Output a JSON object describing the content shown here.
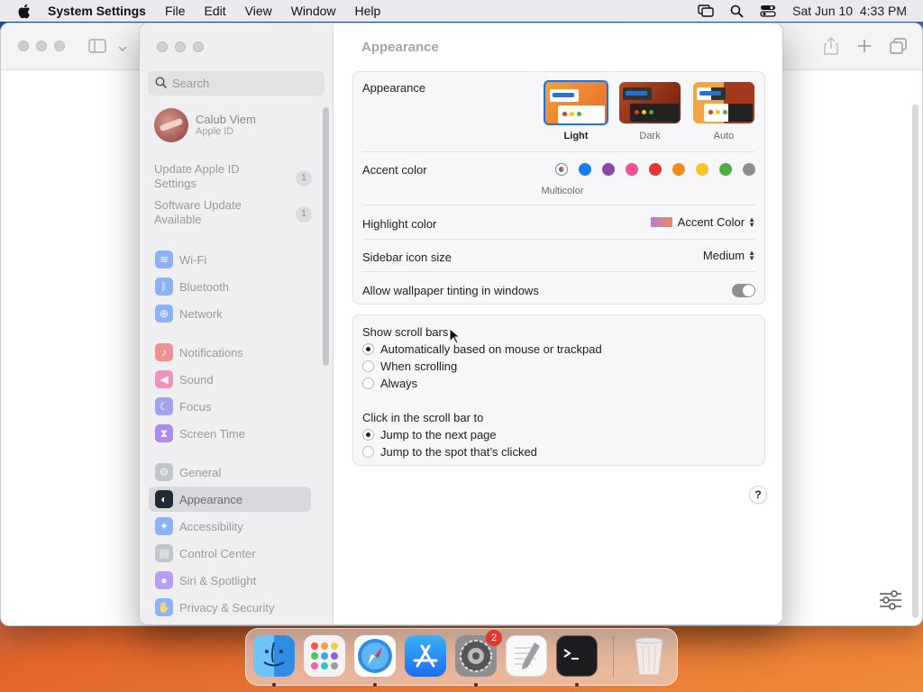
{
  "menubar": {
    "app": "System Settings",
    "menus": [
      "File",
      "Edit",
      "View",
      "Window",
      "Help"
    ],
    "datetime": "Sat Jun 10  4:33 PM"
  },
  "sidebar": {
    "search_placeholder": "Search",
    "profile": {
      "name": "Calub Viem",
      "subtitle": "Apple ID"
    },
    "notices": [
      {
        "label": "Update Apple ID Settings",
        "count": "1"
      },
      {
        "label": "Software Update Available",
        "count": "1"
      }
    ],
    "items": [
      {
        "label": "Wi-Fi",
        "icon": "wifi-icon",
        "color": "#3b82f6"
      },
      {
        "label": "Bluetooth",
        "icon": "bluetooth-icon",
        "color": "#3b82f6"
      },
      {
        "label": "Network",
        "icon": "globe-icon",
        "color": "#3b82f6"
      },
      {
        "label": "Notifications",
        "icon": "bell-icon",
        "color": "#ef4444"
      },
      {
        "label": "Sound",
        "icon": "speaker-icon",
        "color": "#ec4899"
      },
      {
        "label": "Focus",
        "icon": "moon-icon",
        "color": "#6366f1"
      },
      {
        "label": "Screen Time",
        "icon": "hourglass-icon",
        "color": "#7c3aed"
      },
      {
        "label": "General",
        "icon": "gear-icon",
        "color": "#9ca3af"
      },
      {
        "label": "Appearance",
        "icon": "appearance-icon",
        "color": "#1f2937",
        "selected": true
      },
      {
        "label": "Accessibility",
        "icon": "accessibility-icon",
        "color": "#3b82f6"
      },
      {
        "label": "Control Center",
        "icon": "control-center-icon",
        "color": "#9ca3af"
      },
      {
        "label": "Siri & Spotlight",
        "icon": "siri-icon",
        "color": "#8b5cf6"
      },
      {
        "label": "Privacy & Security",
        "icon": "hand-icon",
        "color": "#3b82f6"
      }
    ]
  },
  "main": {
    "title": "Appearance",
    "appearance": {
      "label": "Appearance",
      "options": [
        "Light",
        "Dark",
        "Auto"
      ],
      "selected": "Light"
    },
    "accent": {
      "label": "Accent color",
      "selected_label": "Multicolor",
      "colors": [
        "multicolor",
        "#147efb",
        "#8e44ad",
        "#f0509a",
        "#e5352f",
        "#f28c1e",
        "#f7c325",
        "#4caf3d",
        "#8e8e93"
      ]
    },
    "highlight": {
      "label": "Highlight color",
      "value": "Accent Color"
    },
    "sidebar_icon": {
      "label": "Sidebar icon size",
      "value": "Medium"
    },
    "tinting": {
      "label": "Allow wallpaper tinting in windows",
      "on": false
    },
    "scrollbars": {
      "label": "Show scroll bars",
      "options": [
        "Automatically based on mouse or trackpad",
        "When scrolling",
        "Always"
      ],
      "selected": 0
    },
    "click_scroll": {
      "label": "Click in the scroll bar to",
      "options": [
        "Jump to the next page",
        "Jump to the spot that’s clicked"
      ],
      "selected": 0
    },
    "help": "?"
  },
  "dock": {
    "apps": [
      "Finder",
      "Launchpad",
      "Safari",
      "App Store",
      "System Settings",
      "TextEdit",
      "Terminal",
      "Trash"
    ],
    "settings_badge": "2"
  }
}
